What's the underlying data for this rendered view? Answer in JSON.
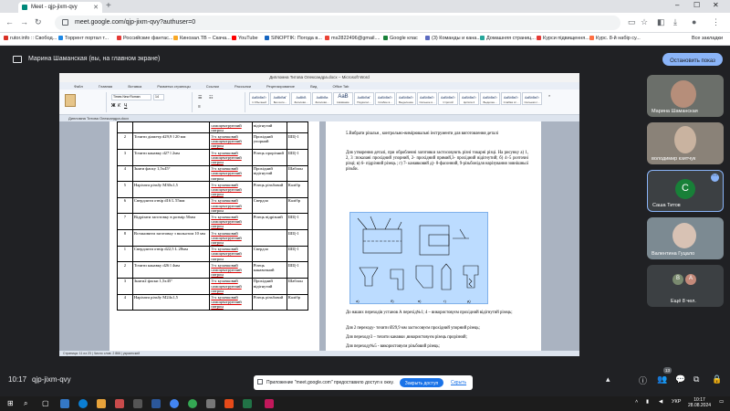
{
  "browser": {
    "tab_title": "Meet - qjp-jixm-qvy",
    "url": "meet.google.com/qjp-jixm-qvy?authuser=0",
    "bookmarks": [
      {
        "label": "rutor.info :: Свобод...",
        "color": "#d93025"
      },
      {
        "label": "Торрент портал т...",
        "color": "#1e88e5"
      },
      {
        "label": "Российские фантас...",
        "color": "#e53935"
      },
      {
        "label": "Кинозал.ТВ – Скача...",
        "color": "#f9a825"
      },
      {
        "label": "YouTube",
        "color": "#ff0000"
      },
      {
        "label": "SINOPTIK: Погода в...",
        "color": "#1565c0"
      },
      {
        "label": "ms2822496@gmail....",
        "color": "#ea4335"
      },
      {
        "label": "Google клас",
        "color": "#188038"
      },
      {
        "label": "(3) Команды и кана...",
        "color": "#5c6bc0"
      },
      {
        "label": "Домашняя страниц...",
        "color": "#26a69a"
      },
      {
        "label": "Курси підвищення...",
        "color": "#e53935"
      },
      {
        "label": "Курс. 8-й набір су...",
        "color": "#ff7043"
      }
    ],
    "all_bookmarks": "Все закладки"
  },
  "meet": {
    "presenting_text": "Марина Шаманская (вы, на главном экране)",
    "stop_button": "Остановить показ",
    "time": "10:17",
    "meeting_code": "qjp-jixm-qvy",
    "people_count": "13",
    "participants": [
      {
        "name": "Марина Шаманская"
      },
      {
        "name": "володимир кзитчук"
      },
      {
        "name": "Саша Титов",
        "initial": "С"
      },
      {
        "name": "Валентина Гуцало"
      },
      {
        "name": "Ещё 8 чел."
      }
    ],
    "more_initials": [
      "В",
      "А"
    ],
    "notice_text": "Приложение \"meet.google.com\" предоставило доступ к окну.",
    "notice_button": "Закрыть доступ",
    "notice_hide": "Скрыть"
  },
  "word": {
    "title": "Дипломна Титова Олександра.docx – Microsoft Word",
    "tabs": [
      "Файл",
      "Главная",
      "Вставка",
      "Разметка страницы",
      "Ссылки",
      "Рассылки",
      "Рецензирование",
      "Вид",
      "Office Tab"
    ],
    "document_tab": "Дипломна Титова Олександра.docx",
    "font_name": "Times New Roman",
    "font_size": "14",
    "styles": [
      {
        "sample": "AaBbВвГг",
        "name": "1 Обычный"
      },
      {
        "sample": "AaBbВвГ",
        "name": "Без инте..."
      },
      {
        "sample": "AaBbВ",
        "name": "Заголово..."
      },
      {
        "sample": "AaBbВв",
        "name": "Заголово..."
      },
      {
        "sample": "AaB",
        "name": "Название"
      },
      {
        "sample": "AaBbВвГ",
        "name": "Подзагол..."
      },
      {
        "sample": "AaBbВвГг",
        "name": "Слабое в..."
      },
      {
        "sample": "AaBbВвГг",
        "name": "Выделение"
      },
      {
        "sample": "AaBbВвГг",
        "name": "Сильное в..."
      },
      {
        "sample": "AaBbВвГг",
        "name": "Строгий"
      },
      {
        "sample": "AaBbВвГг",
        "name": "Цитата 2"
      },
      {
        "sample": "AaBbВвГг",
        "name": "Выделен..."
      },
      {
        "sample": "AaBbВвГг",
        "name": "Слабая сс..."
      },
      {
        "sample": "AaBbВвГг",
        "name": "Сильная с..."
      }
    ],
    "status": "Страница: 11 из 23 | Число слов: 2 866 | украинский",
    "table_rows": [
      {
        "n": "",
        "op": "",
        "fix": "самоцентруючий патрон",
        "tool": "відігнутий",
        "meas": ""
      },
      {
        "n": "2",
        "op": "Точити діаметр d29,9 l 20 мм",
        "fix": "3-х кулачковий самоцентруючий патрон",
        "tool": "Прохідний упорний",
        "meas": "ШЦ-1"
      },
      {
        "n": "3",
        "op": "Точити канавку d27 l 2мм",
        "fix": "3-х кулачковий самоцентруючий патрон",
        "tool": "Різець прорізний",
        "meas": "ШЦ-1"
      },
      {
        "n": "4",
        "op": "Зняти фаску 1,5х45°",
        "fix": "3-х кулачковий самоцентруючий патрон",
        "tool": "Прохідний відігнутий",
        "meas": "Шаблон"
      },
      {
        "n": "5",
        "op": "Нарізати різьбу М30х1,5",
        "fix": "3-х кулачковий самоцентруючий патрон",
        "tool": "Різець різьбовий",
        "meas": "Калібр"
      },
      {
        "n": "6",
        "op": "Свердлити отвір d16 L 55мм",
        "fix": "3-х кулачковий самоцентруючий патрон",
        "tool": "Свердло",
        "meas": "Калібр"
      },
      {
        "n": "7",
        "op": "Відрізати заготовку в розмір 50мм",
        "fix": "3-х кулачковий самоцентруючий патрон",
        "tool": "Різець відрізний",
        "meas": "ШЦ-1"
      },
      {
        "n": "8",
        "op": "Встановити заготовку з вильотом 10 мм",
        "fix": "3-х кулачковий самоцентруючий патрон",
        "tool": "",
        "meas": "ШЦ-1"
      },
      {
        "n": "1",
        "op": "Свердлити отвір d22,5 L 28мм",
        "fix": "3-х кулачковий самоцентруючий патрон",
        "tool": "Свердло",
        "meas": "ШЦ-1"
      },
      {
        "n": "2",
        "op": "Точити канавку d26 l 4мм",
        "fix": "3-х кулачковий самоцентруючий патрон",
        "tool": "Різець канавочний",
        "meas": "ШЦ-1"
      },
      {
        "n": "3",
        "op": "Зняти2 фаски 1,5х45°",
        "fix": "3-х кулачковий самоцентруючий патрон",
        "tool": "Прохідний відігнутий",
        "meas": "Шаблон"
      },
      {
        "n": "4",
        "op": "Нарізати різьбу М24х1,5",
        "fix": "3-х кулачковий самоцентруючий патрон",
        "tool": "Різець різьбовий",
        "meas": "Калібр"
      }
    ],
    "right_text": [
      "5.Вибрати різальн , контрольно-вимірювальні інструменти для виготовлення деталі",
      "Для  утворення  деталі, при обробленні заготовки  застосовують  різні токарні різці. На рисунку а) 1, 2, 3 :показані прохідний упорний, 2- прохідний прямий,3- прохідний відігнутий; б) 4÷5 розточні різці; в) 6- підрізний різець ; г) 7- канавковий д)- 8-фасонний, 9-різьбонідля нарізування зовнішньої різьби.",
      "До наших переходів установ А  перехід№1; 4 – використовуєм прохідний відігнутий різець;",
      "Для 2 переходу- точити  Ø29,9 мм застосовуєм прохідний упорний різець;",
      "Для переходу3 – точити канавки ,використовуєм  різець прорізний;",
      "Для переходу№5  - використовуєм різьбовий різець;"
    ]
  },
  "taskbar": {
    "lang": "УКР",
    "time": "10:17",
    "date": "28.08.2024"
  }
}
